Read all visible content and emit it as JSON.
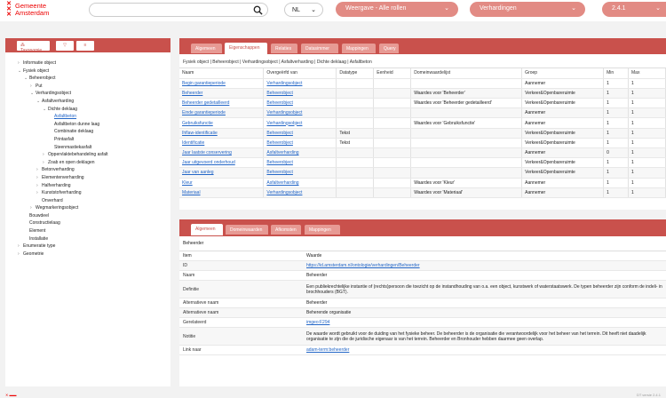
{
  "logo": {
    "line1": "Gemeente",
    "line2": "Amsterdam"
  },
  "search": {
    "placeholder": ""
  },
  "language": "NL",
  "view_selector": "Weergave - Alle rollen",
  "object_selector": "Verhardingen",
  "version": "2.4.1",
  "left_panel": {
    "tabs": [
      "Taxonomie",
      "",
      ""
    ],
    "tree": [
      {
        "label": "Informatie object",
        "depth": 0,
        "arrow": "›"
      },
      {
        "label": "Fysiek object",
        "depth": 0,
        "arrow": "⌄"
      },
      {
        "label": "Beheerobject",
        "depth": 1,
        "arrow": "⌄"
      },
      {
        "label": "Put",
        "depth": 2,
        "arrow": "›"
      },
      {
        "label": "Verhardingsobject",
        "depth": 2,
        "arrow": "⌄"
      },
      {
        "label": "Asfaltverharding",
        "depth": 3,
        "arrow": "⌄"
      },
      {
        "label": "Dichte deklaag",
        "depth": 4,
        "arrow": "⌄"
      },
      {
        "label": "Asfaltbeton",
        "depth": 5,
        "arrow": "",
        "selected": true
      },
      {
        "label": "Asfaltbeton dunne laag",
        "depth": 5,
        "arrow": ""
      },
      {
        "label": "Combinatie deklaag",
        "depth": 5,
        "arrow": ""
      },
      {
        "label": "Printasfalt",
        "depth": 5,
        "arrow": ""
      },
      {
        "label": "Steenmastiekasfalt",
        "depth": 5,
        "arrow": ""
      },
      {
        "label": "Oppervlaktebehandeling asfalt",
        "depth": 4,
        "arrow": "›"
      },
      {
        "label": "Zoab en open deklagen",
        "depth": 4,
        "arrow": "›"
      },
      {
        "label": "Betonverharding",
        "depth": 3,
        "arrow": "›"
      },
      {
        "label": "Elementenverharding",
        "depth": 3,
        "arrow": "›"
      },
      {
        "label": "Halfverharding",
        "depth": 3,
        "arrow": "›"
      },
      {
        "label": "Kunststofverharding",
        "depth": 3,
        "arrow": "›"
      },
      {
        "label": "Onverhard",
        "depth": 3,
        "arrow": ""
      },
      {
        "label": "Wegmarkeringsobject",
        "depth": 2,
        "arrow": "›"
      },
      {
        "label": "Bouwdeel",
        "depth": 1,
        "arrow": ""
      },
      {
        "label": "Constructielaag",
        "depth": 1,
        "arrow": ""
      },
      {
        "label": "Element",
        "depth": 1,
        "arrow": ""
      },
      {
        "label": "Installatie",
        "depth": 1,
        "arrow": ""
      },
      {
        "label": "Enumeratie type",
        "depth": 0,
        "arrow": "›"
      },
      {
        "label": "Geometrie",
        "depth": 0,
        "arrow": "›"
      }
    ]
  },
  "main_panel": {
    "tabs": [
      "Algemeen",
      "Eigenschappen",
      "Relaties",
      "Datasimmer",
      "Mappingen",
      "Query"
    ],
    "active_tab": 1,
    "breadcrumb": "Fysiek object  |  Beheerobject  |  Verhardingsobject  |  Asfaltverharding  |  Dichte deklaag  |  Asfaltbeton",
    "columns": [
      "Naam",
      "Overgeërfd van",
      "Datatype",
      "Eenheid",
      "Domeinwaardelijst",
      "Groep",
      "Min",
      "Max"
    ],
    "rows": [
      [
        "Begin garantieperiode",
        "Verhardingsobject",
        "",
        "",
        "",
        "Aannemer",
        "1",
        "1"
      ],
      [
        "Beheerder",
        "Beheerobject",
        "",
        "",
        "Waardes voor 'Beheerder'",
        "Verkeer&Openbareruimte",
        "1",
        "1"
      ],
      [
        "Beheerder gedetailleerd",
        "Beheerobject",
        "",
        "",
        "Waardes voor 'Beheerder gedetailleerd'",
        "Verkeer&Openbareruimte",
        "1",
        "1"
      ],
      [
        "Einde garantieperiode",
        "Verhardingsobject",
        "",
        "",
        "",
        "Aannemer",
        "1",
        "1"
      ],
      [
        "Gebruiksfunctie",
        "Verhardingsobject",
        "",
        "",
        "Waardes voor 'Gebruiksfunctie'",
        "Aannemer",
        "1",
        "1"
      ],
      [
        "Ihflaw-identificatie",
        "Beheerobject",
        "Tekst",
        "",
        "",
        "Verkeer&Openbareruimte",
        "1",
        "1"
      ],
      [
        "Identificatie",
        "Beheerobject",
        "Tekst",
        "",
        "",
        "Verkeer&Openbareruimte",
        "1",
        "1"
      ],
      [
        "Jaar laatste conservering",
        "Asfaltverharding",
        "",
        "",
        "",
        "Aannemer",
        "0",
        "1"
      ],
      [
        "Jaar uitgevoerd onderhoud",
        "Beheerobject",
        "",
        "",
        "",
        "Verkeer&Openbareruimte",
        "1",
        "1"
      ],
      [
        "Jaar van aanleg",
        "Beheerobject",
        "",
        "",
        "",
        "Verkeer&Openbareruimte",
        "1",
        "1"
      ],
      [
        "Kleur",
        "Asfaltverharding",
        "",
        "",
        "Waardes voor 'Kleur'",
        "Aannemer",
        "1",
        "1"
      ],
      [
        "Materiaal",
        "Verhardingsobject",
        "",
        "",
        "Waardes voor 'Materiaal'",
        "Aannemer",
        "1",
        "1"
      ]
    ]
  },
  "detail_panel": {
    "tabs": [
      "Algemeen",
      "Domeinwaarden",
      "Afkomsten",
      "Mappingen"
    ],
    "active_tab": 0,
    "title": "Beheerder",
    "columns": [
      "Item",
      "Waarde"
    ],
    "rows": [
      {
        "key": "ID",
        "value": "https://id.amsterdam.nl/ontologie/verhardingen/Beheerder",
        "link": true
      },
      {
        "key": "Naam",
        "value": "Beheerder",
        "link": false
      },
      {
        "key": "Definitie",
        "value": "Een publiekrechtelijke instantie of (rechts)persoon die toezicht op de instandhouding van o.a. een object, kunstwerk of waterstaatswerk. De typen beheerder zijn conform de indeli- in brochhouders (BGT).",
        "link": false
      },
      {
        "key": "Alternatieve naam",
        "value": "Beheerder",
        "link": false
      },
      {
        "key": "Alternatieve naam",
        "value": "Beherende organisatie",
        "link": false
      },
      {
        "key": "Gerelateerd",
        "value": "imgeo:F294",
        "link": true
      },
      {
        "key": "Notitie",
        "value": "De waarde wordt gebruikt voor de duiding van het fysieke beheer. De beheerder is de organisatie die verantwoordelijk voor het beheer van het terrein. Dit heeft niet daadelijk organisatie te zijn die de juridische eigenaar is van het terrein. Beheerder en Bronhouder hebben daarmee geen overlap.",
        "link": false
      },
      {
        "key": "Link naar",
        "value": "adam-term:beheerder",
        "link": true
      }
    ]
  },
  "footer": {
    "left": "",
    "right": "DT versie 2.4.1"
  },
  "colors": {
    "brand_red": "#ec0000",
    "panel_header": "#c9514c",
    "pill": "#e28b84",
    "link": "#2366c7"
  }
}
